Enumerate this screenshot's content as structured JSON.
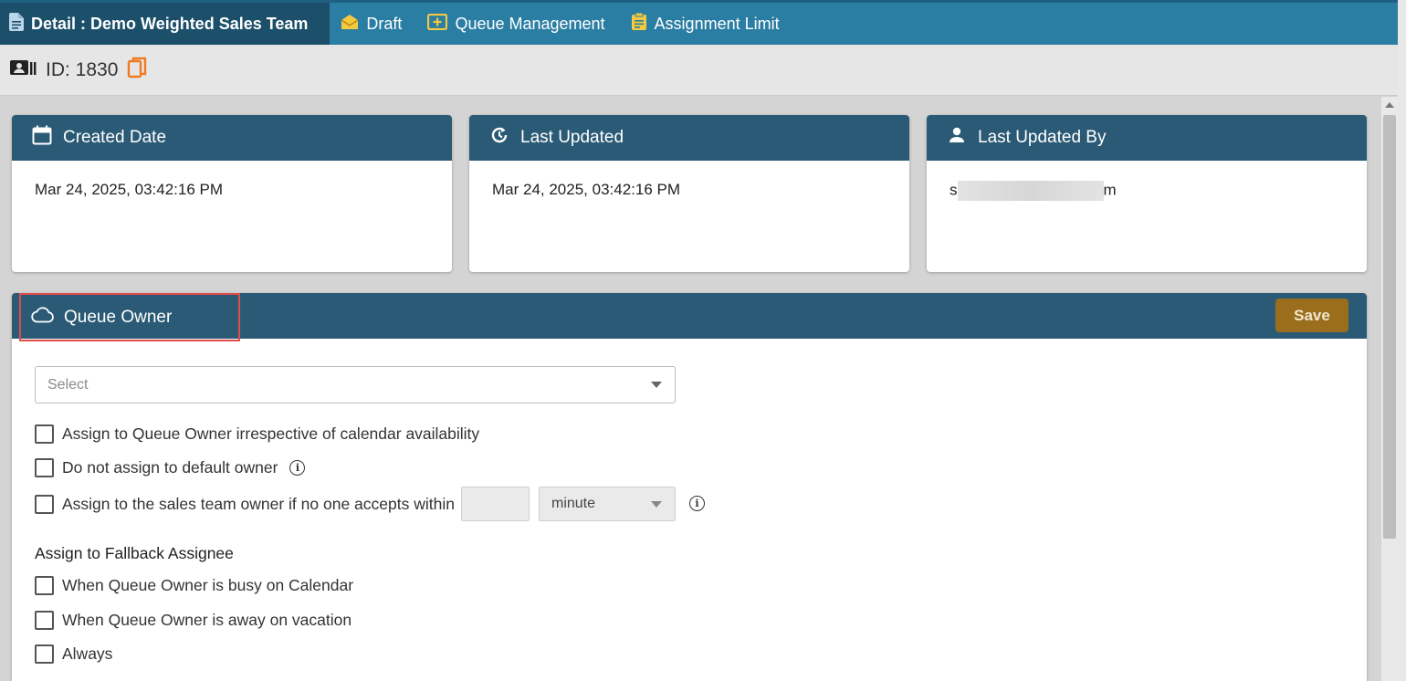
{
  "tabs": [
    {
      "label": "Detail : Demo Weighted Sales Team",
      "icon": "document-icon",
      "active": true
    },
    {
      "label": "Draft",
      "icon": "envelope-open-icon",
      "active": false
    },
    {
      "label": "Queue Management",
      "icon": "add-box-icon",
      "active": false
    },
    {
      "label": "Assignment Limit",
      "icon": "clipboard-icon",
      "active": false
    }
  ],
  "idbar": {
    "text": "ID: 1830",
    "icon": "id-card-icon",
    "copy_icon": "copy-icon"
  },
  "cards": [
    {
      "title": "Created Date",
      "icon": "calendar-icon",
      "value": "Mar 24, 2025, 03:42:16 PM"
    },
    {
      "title": "Last Updated",
      "icon": "history-icon",
      "value": "Mar 24, 2025, 03:42:16 PM"
    },
    {
      "title": "Last Updated By",
      "icon": "person-icon",
      "value_prefix": "s",
      "value_suffix": "m"
    }
  ],
  "queue_owner": {
    "title": "Queue Owner",
    "icon": "cloud-icon",
    "save_label": "Save",
    "select_placeholder": "Select",
    "options": [
      {
        "label": "Assign to Queue Owner irrespective of calendar availability",
        "checked": false,
        "info": false
      },
      {
        "label": "Do not assign to default owner",
        "checked": false,
        "info": true
      },
      {
        "label": "Assign to the sales team owner if no one accepts within",
        "checked": false,
        "info": true
      }
    ],
    "timeout_value": "",
    "timeout_unit": "minute",
    "fallback_title": "Assign to Fallback Assignee",
    "fallback_options": [
      {
        "label": "When Queue Owner is busy on Calendar",
        "checked": false
      },
      {
        "label": "When Queue Owner is away on vacation",
        "checked": false
      },
      {
        "label": "Always",
        "checked": false
      }
    ]
  },
  "colors": {
    "tabbar": "#2a7ea3",
    "active_tab": "#1c4f69",
    "card_header": "#2a5a75",
    "save_button": "#9a6e1c",
    "highlight_border": "#e14b4b",
    "tab_icon_yellow": "#f3c941"
  }
}
